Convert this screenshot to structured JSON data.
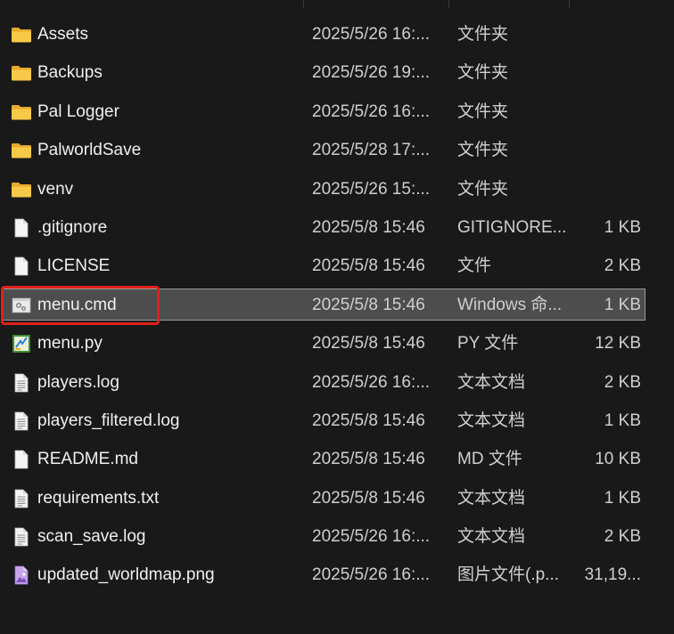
{
  "files": [
    {
      "name": "Assets",
      "date": "2025/5/26 16:...",
      "type": "文件夹",
      "size": "",
      "icon": "folder-icon",
      "selected": false
    },
    {
      "name": "Backups",
      "date": "2025/5/26 19:...",
      "type": "文件夹",
      "size": "",
      "icon": "folder-icon",
      "selected": false
    },
    {
      "name": "Pal Logger",
      "date": "2025/5/26 16:...",
      "type": "文件夹",
      "size": "",
      "icon": "folder-icon",
      "selected": false
    },
    {
      "name": "PalworldSave",
      "date": "2025/5/28 17:...",
      "type": "文件夹",
      "size": "",
      "icon": "folder-icon",
      "selected": false
    },
    {
      "name": "venv",
      "date": "2025/5/26 15:...",
      "type": "文件夹",
      "size": "",
      "icon": "folder-icon",
      "selected": false
    },
    {
      "name": ".gitignore",
      "date": "2025/5/8 15:46",
      "type": "GITIGNORE...",
      "size": "1 KB",
      "icon": "blank-file-icon",
      "selected": false
    },
    {
      "name": "LICENSE",
      "date": "2025/5/8 15:46",
      "type": "文件",
      "size": "2 KB",
      "icon": "blank-file-icon",
      "selected": false
    },
    {
      "name": "menu.cmd",
      "date": "2025/5/8 15:46",
      "type": "Windows 命...",
      "size": "1 KB",
      "icon": "cmd-file-icon",
      "selected": true
    },
    {
      "name": "menu.py",
      "date": "2025/5/8 15:46",
      "type": "PY 文件",
      "size": "12 KB",
      "icon": "python-file-icon",
      "selected": false
    },
    {
      "name": "players.log",
      "date": "2025/5/26 16:...",
      "type": "文本文档",
      "size": "2 KB",
      "icon": "text-file-icon",
      "selected": false
    },
    {
      "name": "players_filtered.log",
      "date": "2025/5/8 15:46",
      "type": "文本文档",
      "size": "1 KB",
      "icon": "text-file-icon",
      "selected": false
    },
    {
      "name": "README.md",
      "date": "2025/5/8 15:46",
      "type": "MD 文件",
      "size": "10 KB",
      "icon": "blank-file-icon",
      "selected": false
    },
    {
      "name": "requirements.txt",
      "date": "2025/5/8 15:46",
      "type": "文本文档",
      "size": "1 KB",
      "icon": "text-file-icon",
      "selected": false
    },
    {
      "name": "scan_save.log",
      "date": "2025/5/26 16:...",
      "type": "文本文档",
      "size": "2 KB",
      "icon": "text-file-icon",
      "selected": false
    },
    {
      "name": "updated_worldmap.png",
      "date": "2025/5/26 16:...",
      "type": "图片文件(.p...",
      "size": "31,19...",
      "icon": "image-file-icon",
      "selected": false
    }
  ],
  "colors": {
    "background": "#191919",
    "selection": "#4d4d4d",
    "highlight_annotation": "#e0201b",
    "folder": "#f5c143"
  }
}
